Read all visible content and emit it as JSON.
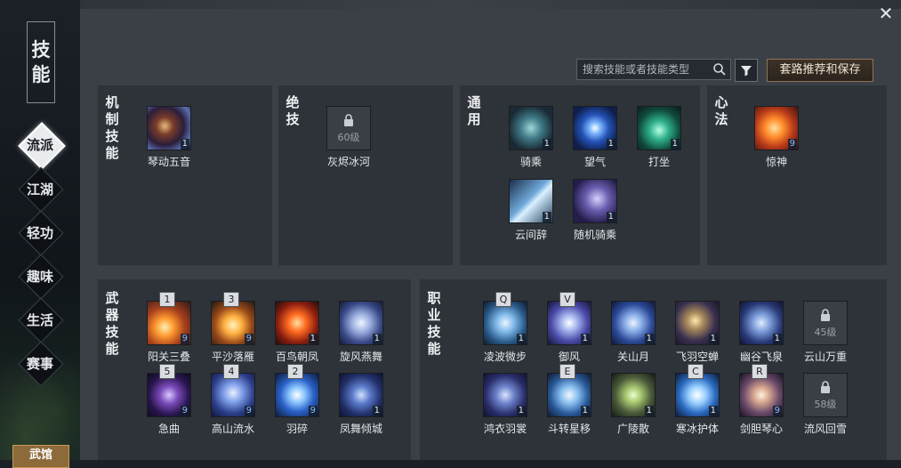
{
  "window": {
    "title_chars": [
      "技",
      "能"
    ],
    "close_label": "✕"
  },
  "nav": [
    {
      "label": "流派",
      "active": true
    },
    {
      "label": "江湖",
      "active": false
    },
    {
      "label": "轻功",
      "active": false
    },
    {
      "label": "趣味",
      "active": false
    },
    {
      "label": "生活",
      "active": false
    },
    {
      "label": "赛事",
      "active": false
    }
  ],
  "nav_bottom": "武馆",
  "search": {
    "placeholder": "搜索技能或者技能类型"
  },
  "recommend_button": "套路推荐和保存",
  "panels": {
    "mechanism": {
      "label": "机制技能",
      "skills": [
        {
          "name": "琴动五音",
          "level": "1",
          "icon": "qin-icon"
        }
      ]
    },
    "ultimate": {
      "label": "绝技",
      "skills": [
        {
          "name": "灰烬冰河",
          "locked": true,
          "lock_text": "60级",
          "icon": "lock-icon"
        }
      ]
    },
    "common": {
      "label": "通用",
      "skills": [
        {
          "name": "骑乘",
          "level": "1",
          "icon": "horse-icon"
        },
        {
          "name": "望气",
          "level": "1",
          "icon": "eye-icon"
        },
        {
          "name": "打坐",
          "level": "1",
          "icon": "meditate-icon"
        },
        {
          "name": "云间辞",
          "level": "1",
          "icon": "cloud-icon"
        },
        {
          "name": "随机骑乘",
          "level": "1",
          "icon": "random-horse-icon"
        }
      ]
    },
    "mind": {
      "label": "心法",
      "skills": [
        {
          "name": "惊神",
          "level": "9",
          "icon": "phoenix-icon"
        }
      ]
    },
    "weapon": {
      "label": "武器技能",
      "skills": [
        {
          "name": "阳关三叠",
          "level": "9",
          "key": "1"
        },
        {
          "name": "平沙落雁",
          "level": "9",
          "key": "3"
        },
        {
          "name": "百鸟朝凤",
          "level": "1",
          "key": ""
        },
        {
          "name": "旋风燕舞",
          "level": "1",
          "key": ""
        },
        {
          "name": "急曲",
          "level": "9",
          "key": "5"
        },
        {
          "name": "高山流水",
          "level": "9",
          "key": "4"
        },
        {
          "name": "羽碎",
          "level": "9",
          "key": "2"
        },
        {
          "name": "凤舞倾城",
          "level": "1",
          "key": ""
        }
      ]
    },
    "profession": {
      "label": "职业技能",
      "skills": [
        {
          "name": "凌波微步",
          "level": "1",
          "key": "Q"
        },
        {
          "name": "御风",
          "level": "1",
          "key": "V"
        },
        {
          "name": "关山月",
          "level": "1",
          "key": ""
        },
        {
          "name": "飞羽空蝉",
          "level": "1",
          "key": ""
        },
        {
          "name": "幽谷飞泉",
          "level": "1",
          "key": ""
        },
        {
          "name": "云山万重",
          "locked": true,
          "lock_text": "45级",
          "key": ""
        },
        {
          "name": "鸿衣羽裳",
          "level": "1",
          "key": ""
        },
        {
          "name": "斗转星移",
          "level": "1",
          "key": "E"
        },
        {
          "name": "广陵散",
          "level": "1",
          "key": ""
        },
        {
          "name": "寒冰护体",
          "level": "1",
          "key": "C"
        },
        {
          "name": "剑胆琴心",
          "level": "9",
          "key": "R"
        },
        {
          "name": "流风回雪",
          "locked": true,
          "lock_text": "58级",
          "key": ""
        }
      ]
    }
  },
  "colors": {
    "accent_button": "#8f7450",
    "level_blue": "#8fb9ff"
  }
}
